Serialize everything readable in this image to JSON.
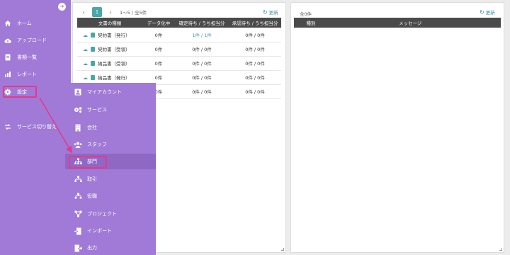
{
  "sidebar": {
    "collapse_icon": "arrow-left-icon",
    "items": [
      {
        "label": "ホーム",
        "icon": "home-icon"
      },
      {
        "label": "アップロード",
        "icon": "cloud-upload-icon"
      },
      {
        "label": "書類一覧",
        "icon": "document-icon"
      },
      {
        "label": "レポート",
        "icon": "chart-icon"
      },
      {
        "label": "設定",
        "icon": "gear-icon"
      },
      {
        "label": "サービス切り替え",
        "icon": "switch-icon"
      }
    ]
  },
  "left_panel": {
    "current_page": "1",
    "count_text": "1〜5 / 全5件",
    "refresh_label": "更新",
    "columns": [
      "文書の種類",
      "データ化中",
      "確定待ち / うち担当分",
      "承認待ち / うち担当分"
    ],
    "rows": [
      {
        "doc": "契約書（発行）",
        "processing": "0件",
        "confirm": "1件 / 1件",
        "approve": "0件 / 0件"
      },
      {
        "doc": "契約書（受領）",
        "processing": "0件",
        "confirm": "0件 / 0件",
        "approve": "0件 / 0件"
      },
      {
        "doc": "納品書（受領）",
        "processing": "0件",
        "confirm": "0件 / 0件",
        "approve": "0件 / 0件"
      },
      {
        "doc": "納品書（発行）",
        "processing": "0件",
        "confirm": "0件 / 0件",
        "approve": "0件 / 0件"
      },
      {
        "doc": "",
        "processing": "0件",
        "confirm": "0件 / 0件",
        "approve": "0件 / 0件"
      }
    ]
  },
  "right_panel": {
    "total_text": "全0件",
    "refresh_label": "更新",
    "columns": [
      "種別",
      "メッセージ"
    ]
  },
  "submenu": {
    "items": [
      {
        "label": "マイアカウント",
        "icon": "user-card-icon"
      },
      {
        "label": "サービス",
        "icon": "gears-icon"
      },
      {
        "label": "会社",
        "icon": "building-icon"
      },
      {
        "label": "スタッフ",
        "icon": "users-icon"
      },
      {
        "label": "部門",
        "icon": "org-chart-icon"
      },
      {
        "label": "取引",
        "icon": "org-chart-icon"
      },
      {
        "label": "役職",
        "icon": "hierarchy-icon"
      },
      {
        "label": "プロジェクト",
        "icon": "project-icon"
      },
      {
        "label": "インポート",
        "icon": "import-icon"
      },
      {
        "label": "出力",
        "icon": "export-icon"
      }
    ]
  },
  "colors": {
    "sidebar": "#a07ad6",
    "accent": "#4aa6a8",
    "highlight": "#e23a8c",
    "header": "#4a4a4a"
  }
}
